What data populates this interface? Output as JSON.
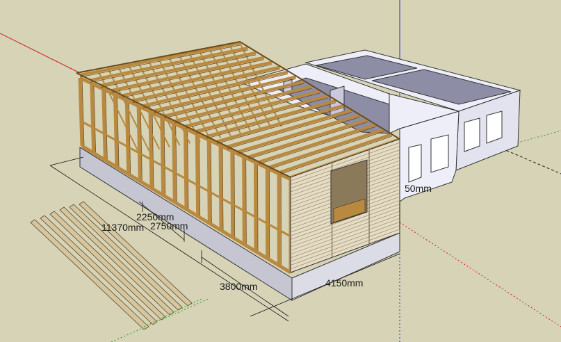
{
  "viewport": {
    "background": "#d6d3b7",
    "axis_colors": {
      "red": "#d02020",
      "green": "#2a9a2a",
      "blue": "#2030d0"
    }
  },
  "colors": {
    "wall_light": "#eeeef8",
    "wall_mid": "#c9c9dc",
    "wall_dark": "#a9a9c2",
    "timber": "#b8893e",
    "timber_dark": "#6b4a1a",
    "cladding": "#e6dcc3",
    "foundation": "#dcdce6",
    "foundation_side": "#c6c6d2"
  },
  "dimensions": [
    {
      "id": "dim-2250",
      "text": "2250mm"
    },
    {
      "id": "dim-2750",
      "text": "2750mm"
    },
    {
      "id": "dim-11370",
      "text": "11370mm"
    },
    {
      "id": "dim-3800",
      "text": "3800mm"
    },
    {
      "id": "dim-4150",
      "text": "4150mm"
    },
    {
      "id": "dim-partial",
      "text": "50mm"
    }
  ]
}
